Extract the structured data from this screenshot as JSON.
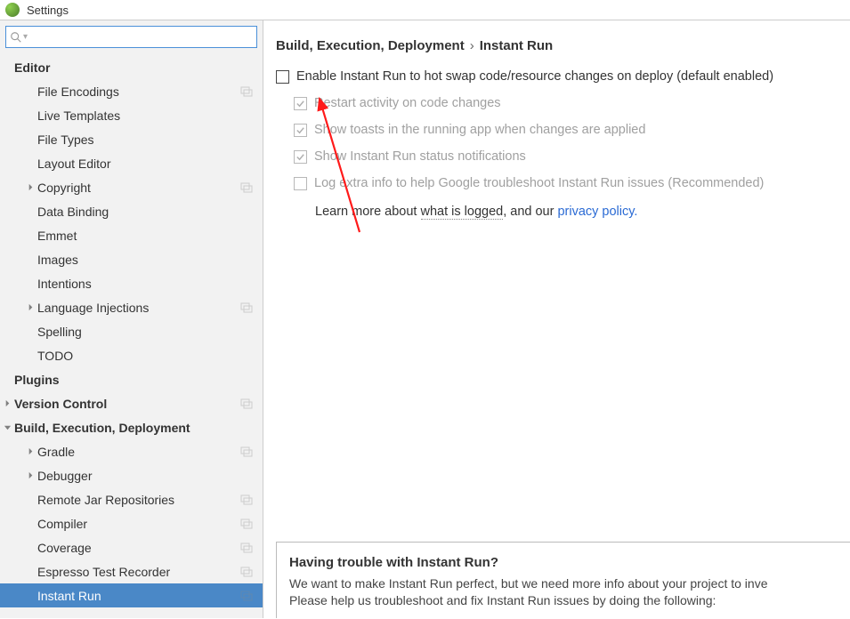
{
  "window": {
    "title": "Settings"
  },
  "search": {
    "placeholder": ""
  },
  "sidebar": {
    "items": [
      {
        "label": "Editor",
        "bold": true,
        "indent": 1,
        "tw": "",
        "badge": false
      },
      {
        "label": "File Encodings",
        "bold": false,
        "indent": 2,
        "tw": "",
        "badge": true
      },
      {
        "label": "Live Templates",
        "bold": false,
        "indent": 2,
        "tw": "",
        "badge": false
      },
      {
        "label": "File Types",
        "bold": false,
        "indent": 2,
        "tw": "",
        "badge": false
      },
      {
        "label": "Layout Editor",
        "bold": false,
        "indent": 2,
        "tw": "",
        "badge": false
      },
      {
        "label": "Copyright",
        "bold": false,
        "indent": 2,
        "tw": "right",
        "badge": true
      },
      {
        "label": "Data Binding",
        "bold": false,
        "indent": 2,
        "tw": "",
        "badge": false
      },
      {
        "label": "Emmet",
        "bold": false,
        "indent": 2,
        "tw": "",
        "badge": false
      },
      {
        "label": "Images",
        "bold": false,
        "indent": 2,
        "tw": "",
        "badge": false
      },
      {
        "label": "Intentions",
        "bold": false,
        "indent": 2,
        "tw": "",
        "badge": false
      },
      {
        "label": "Language Injections",
        "bold": false,
        "indent": 2,
        "tw": "right",
        "badge": true
      },
      {
        "label": "Spelling",
        "bold": false,
        "indent": 2,
        "tw": "",
        "badge": false
      },
      {
        "label": "TODO",
        "bold": false,
        "indent": 2,
        "tw": "",
        "badge": false
      },
      {
        "label": "Plugins",
        "bold": true,
        "indent": 1,
        "tw": "",
        "badge": false
      },
      {
        "label": "Version Control",
        "bold": true,
        "indent": 1,
        "tw": "right",
        "badge": true
      },
      {
        "label": "Build, Execution, Deployment",
        "bold": true,
        "indent": 1,
        "tw": "down",
        "badge": false
      },
      {
        "label": "Gradle",
        "bold": false,
        "indent": 2,
        "tw": "right",
        "badge": true
      },
      {
        "label": "Debugger",
        "bold": false,
        "indent": 2,
        "tw": "right",
        "badge": false
      },
      {
        "label": "Remote Jar Repositories",
        "bold": false,
        "indent": 2,
        "tw": "",
        "badge": true
      },
      {
        "label": "Compiler",
        "bold": false,
        "indent": 2,
        "tw": "",
        "badge": true
      },
      {
        "label": "Coverage",
        "bold": false,
        "indent": 2,
        "tw": "",
        "badge": true
      },
      {
        "label": "Espresso Test Recorder",
        "bold": false,
        "indent": 2,
        "tw": "",
        "badge": true
      },
      {
        "label": "Instant Run",
        "bold": false,
        "indent": 2,
        "tw": "",
        "badge": true,
        "selected": true
      }
    ]
  },
  "breadcrumb": {
    "a": "Build, Execution, Deployment",
    "b": "Instant Run"
  },
  "options": {
    "main": "Enable Instant Run to hot swap code/resource changes on deploy (default enabled)",
    "subs": [
      "Restart activity on code changes",
      "Show toasts in the running app when changes are applied",
      "Show Instant Run status notifications",
      "Log extra info to help Google troubleshoot Instant Run issues (Recommended)"
    ]
  },
  "learn": {
    "pre": "Learn more about ",
    "l1": "what is logged",
    "mid": ", and our ",
    "l2": "privacy policy."
  },
  "help": {
    "title": "Having trouble with Instant Run?",
    "p1": "We want to make Instant Run perfect, but we need more info about your project to inve",
    "p2": "Please help us troubleshoot and fix Instant Run issues by doing the following:"
  }
}
